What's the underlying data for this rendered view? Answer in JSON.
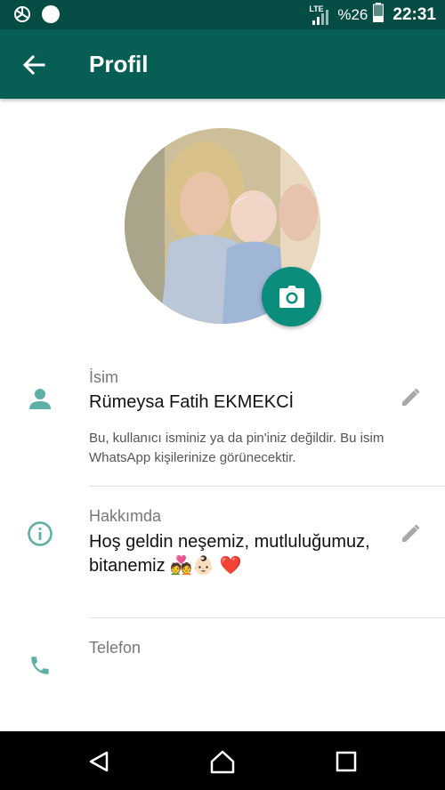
{
  "status_bar": {
    "network_type": "LTE",
    "battery": "%26",
    "time": "22:31"
  },
  "app_bar": {
    "title": "Profil"
  },
  "profile": {
    "name_label": "İsim",
    "name": "Rümeysa Fatih EKMEKCİ",
    "name_hint": "Bu, kullanıcı isminiz ya da pin'iniz değildir. Bu isim WhatsApp kişilerinize görünecektir.",
    "about_label": "Hakkımda",
    "about": "Hoş geldin neşemiz, mutluluğumuz, bitanemiz 💑👶🏻 ❤️",
    "phone_label": "Telefon"
  },
  "colors": {
    "primary_dark": "#054d44",
    "primary": "#075e54",
    "accent": "#0a8d7a",
    "icon_teal": "#5fb0a4"
  }
}
